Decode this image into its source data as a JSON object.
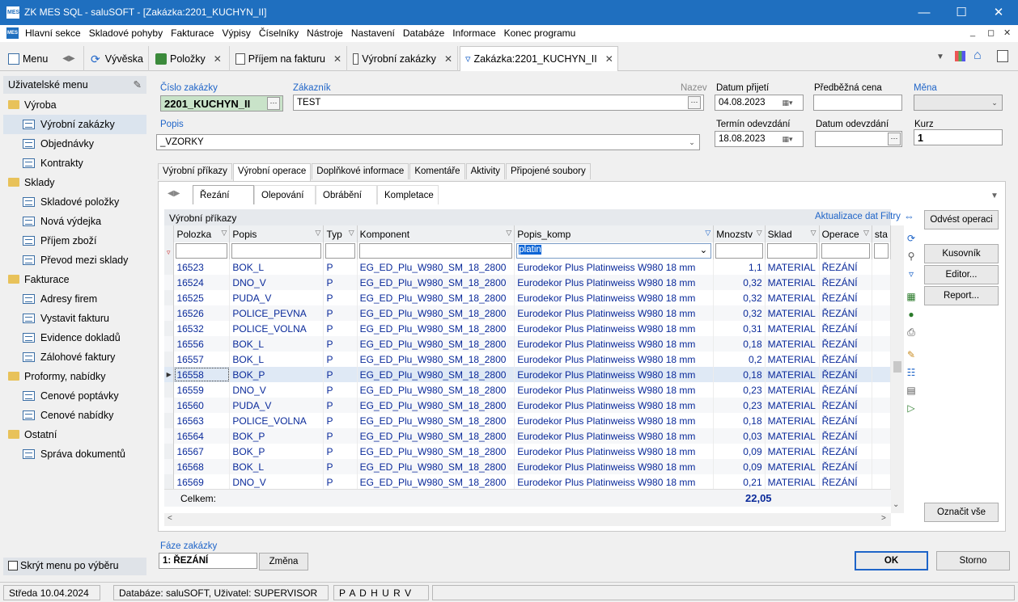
{
  "window": {
    "title": "ZK MES SQL - saluSOFT - [Zakázka:2201_KUCHYN_II]",
    "logo": "MES"
  },
  "menu": [
    "Hlavní sekce",
    "Skladové pohyby",
    "Fakturace",
    "Výpisy",
    "Číselníky",
    "Nástroje",
    "Nastavení",
    "Databáze",
    "Informace",
    "Konec programu"
  ],
  "tabs": [
    {
      "label": "Menu"
    },
    {
      "label": "Vývěska"
    },
    {
      "label": "Položky"
    },
    {
      "label": "Příjem na fakturu"
    },
    {
      "label": "Výrobní zakázky"
    },
    {
      "label": "Zakázka:2201_KUCHYN_II"
    }
  ],
  "sidebar": {
    "header": "Uživatelské menu",
    "items": [
      {
        "label": "Výroba",
        "type": "cat"
      },
      {
        "label": "Výrobní zakázky",
        "type": "sub",
        "selected": true
      },
      {
        "label": "Objednávky",
        "type": "sub"
      },
      {
        "label": "Kontrakty",
        "type": "sub"
      },
      {
        "label": "Sklady",
        "type": "cat"
      },
      {
        "label": "Skladové položky",
        "type": "sub"
      },
      {
        "label": "Nová výdejka",
        "type": "sub"
      },
      {
        "label": "Příjem zboží",
        "type": "sub"
      },
      {
        "label": "Převod mezi sklady",
        "type": "sub"
      },
      {
        "label": "Fakturace",
        "type": "cat"
      },
      {
        "label": "Adresy firem",
        "type": "sub"
      },
      {
        "label": "Vystavit fakturu",
        "type": "sub"
      },
      {
        "label": "Evidence dokladů",
        "type": "sub"
      },
      {
        "label": "Zálohové faktury",
        "type": "sub"
      },
      {
        "label": "Proformy, nabídky",
        "type": "cat"
      },
      {
        "label": "Cenové poptávky",
        "type": "sub"
      },
      {
        "label": "Cenové nabídky",
        "type": "sub"
      },
      {
        "label": "Ostatní",
        "type": "cat"
      },
      {
        "label": "Správa dokumentů",
        "type": "sub"
      }
    ],
    "hide_menu": "Skrýt menu po výběru"
  },
  "form": {
    "cislo_label": "Číslo zakázky",
    "cislo_value": "2201_KUCHYN_II",
    "zakaznik_label": "Zákazník",
    "zakaznik_value": "TEST",
    "nazev_label": "Nazev",
    "popis_label": "Popis",
    "popis_value": "_VZORKY",
    "datum_prijeti_label": "Datum přijetí",
    "datum_prijeti_value": "04.08.2023",
    "predbezna_label": "Předběžná cena",
    "predbezna_value": "",
    "mena_label": "Měna",
    "mena_value": "",
    "termin_label": "Termín odevzdání",
    "termin_value": "18.08.2023",
    "datum_odevzdani_label": "Datum odevzdání",
    "datum_odevzdani_value": "",
    "kurz_label": "Kurz",
    "kurz_value": "1"
  },
  "subtabs": [
    "Výrobní příkazy",
    "Výrobní operace",
    "Doplňkové informace",
    "Komentáře",
    "Aktivity",
    "Připojené soubory"
  ],
  "optabs": [
    "Řezání",
    "Olepování",
    "Obrábění",
    "Kompletace"
  ],
  "grid": {
    "title": "Výrobní příkazy",
    "links": {
      "update": "Aktualizace dat",
      "filters": "Filtry"
    },
    "columns": [
      "Polozka",
      "Popis",
      "Typ",
      "Komponent",
      "Popis_komp",
      "Mnozstv",
      "Sklad",
      "Operace",
      "sta"
    ],
    "filter_popis_komp": "platin",
    "rows": [
      [
        "16523",
        "BOK_L",
        "P",
        "EG_ED_Plu_W980_SM_18_2800",
        "Eurodekor Plus Platinweiss W980 18 mm",
        "1,1",
        "MATERIAL",
        "ŘEZÁNÍ"
      ],
      [
        "16524",
        "DNO_V",
        "P",
        "EG_ED_Plu_W980_SM_18_2800",
        "Eurodekor Plus Platinweiss W980 18 mm",
        "0,32",
        "MATERIAL",
        "ŘEZÁNÍ"
      ],
      [
        "16525",
        "PUDA_V",
        "P",
        "EG_ED_Plu_W980_SM_18_2800",
        "Eurodekor Plus Platinweiss W980 18 mm",
        "0,32",
        "MATERIAL",
        "ŘEZÁNÍ"
      ],
      [
        "16526",
        "POLICE_PEVNA",
        "P",
        "EG_ED_Plu_W980_SM_18_2800",
        "Eurodekor Plus Platinweiss W980 18 mm",
        "0,32",
        "MATERIAL",
        "ŘEZÁNÍ"
      ],
      [
        "16532",
        "POLICE_VOLNA",
        "P",
        "EG_ED_Plu_W980_SM_18_2800",
        "Eurodekor Plus Platinweiss W980 18 mm",
        "0,31",
        "MATERIAL",
        "ŘEZÁNÍ"
      ],
      [
        "16556",
        "BOK_L",
        "P",
        "EG_ED_Plu_W980_SM_18_2800",
        "Eurodekor Plus Platinweiss W980 18 mm",
        "0,18",
        "MATERIAL",
        "ŘEZÁNÍ"
      ],
      [
        "16557",
        "BOK_L",
        "P",
        "EG_ED_Plu_W980_SM_18_2800",
        "Eurodekor Plus Platinweiss W980 18 mm",
        "0,2",
        "MATERIAL",
        "ŘEZÁNÍ"
      ],
      [
        "16558",
        "BOK_P",
        "P",
        "EG_ED_Plu_W980_SM_18_2800",
        "Eurodekor Plus Platinweiss W980 18 mm",
        "0,18",
        "MATERIAL",
        "ŘEZÁNÍ"
      ],
      [
        "16559",
        "DNO_V",
        "P",
        "EG_ED_Plu_W980_SM_18_2800",
        "Eurodekor Plus Platinweiss W980 18 mm",
        "0,23",
        "MATERIAL",
        "ŘEZÁNÍ"
      ],
      [
        "16560",
        "PUDA_V",
        "P",
        "EG_ED_Plu_W980_SM_18_2800",
        "Eurodekor Plus Platinweiss W980 18 mm",
        "0,23",
        "MATERIAL",
        "ŘEZÁNÍ"
      ],
      [
        "16563",
        "POLICE_VOLNA",
        "P",
        "EG_ED_Plu_W980_SM_18_2800",
        "Eurodekor Plus Platinweiss W980 18 mm",
        "0,18",
        "MATERIAL",
        "ŘEZÁNÍ"
      ],
      [
        "16564",
        "BOK_P",
        "P",
        "EG_ED_Plu_W980_SM_18_2800",
        "Eurodekor Plus Platinweiss W980 18 mm",
        "0,03",
        "MATERIAL",
        "ŘEZÁNÍ"
      ],
      [
        "16567",
        "BOK_P",
        "P",
        "EG_ED_Plu_W980_SM_18_2800",
        "Eurodekor Plus Platinweiss W980 18 mm",
        "0,09",
        "MATERIAL",
        "ŘEZÁNÍ"
      ],
      [
        "16568",
        "BOK_L",
        "P",
        "EG_ED_Plu_W980_SM_18_2800",
        "Eurodekor Plus Platinweiss W980 18 mm",
        "0,09",
        "MATERIAL",
        "ŘEZÁNÍ"
      ],
      [
        "16569",
        "DNO_V",
        "P",
        "EG_ED_Plu_W980_SM_18_2800",
        "Eurodekor Plus Platinweiss W980 18 mm",
        "0,21",
        "MATERIAL",
        "ŘEZÁNÍ"
      ]
    ],
    "current_row": 7,
    "total_label": "Celkem:",
    "total_value": "22,05"
  },
  "buttons": {
    "odvest": "Odvést operaci",
    "kusovnik": "Kusovník",
    "editor": "Editor...",
    "report": "Report...",
    "oznacit": "Označit vše",
    "ok": "OK",
    "storno": "Storno",
    "zmena": "Změna"
  },
  "faze": {
    "label": "Fáze zakázky",
    "value": "1: ŘEZÁNÍ"
  },
  "status": {
    "date": "Středa 10.04.2024",
    "db": "Databáze: saluSOFT, Uživatel: SUPERVISOR",
    "flags": "P A D H U R V"
  }
}
